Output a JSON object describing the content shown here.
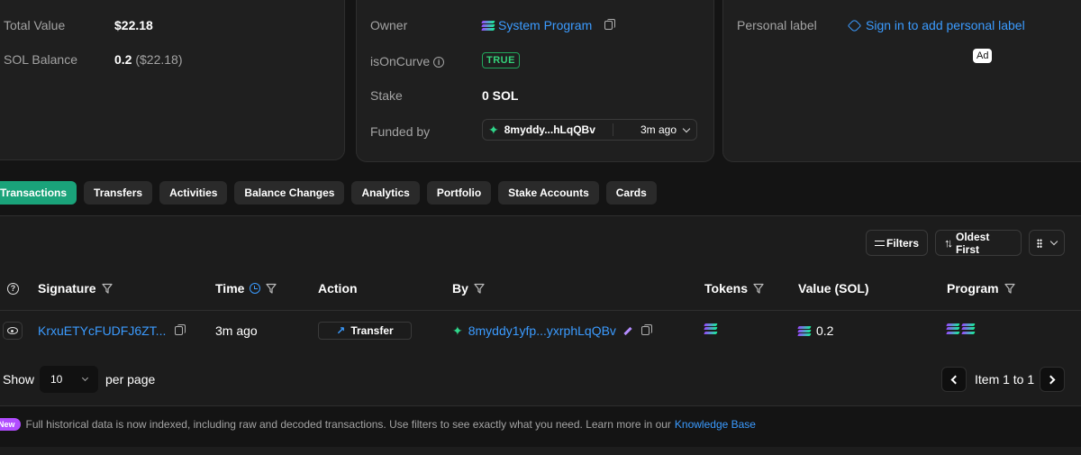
{
  "overview": {
    "total_value_label": "Total Value",
    "total_value": "$22.18",
    "sol_balance_label": "SOL Balance",
    "sol_balance": "0.2",
    "sol_balance_usd": "($22.18)"
  },
  "details": {
    "owner_label": "Owner",
    "owner_value": "System Program",
    "is_on_curve_label": "isOnCurve",
    "is_on_curve_value": "TRUE",
    "stake_label": "Stake",
    "stake_value": "0 SOL",
    "funded_by_label": "Funded by",
    "funded_by_address": "8myddy...hLqQBv",
    "funded_by_time": "3m ago"
  },
  "personal": {
    "label": "Personal label",
    "sign_in_link": "Sign in to add personal label",
    "ad_badge": "Ad"
  },
  "tabs": [
    {
      "label": "Transactions",
      "active": true
    },
    {
      "label": "Transfers"
    },
    {
      "label": "Activities"
    },
    {
      "label": "Balance Changes"
    },
    {
      "label": "Analytics"
    },
    {
      "label": "Portfolio"
    },
    {
      "label": "Stake Accounts"
    },
    {
      "label": "Cards"
    }
  ],
  "toolbar": {
    "filters_label": "Filters",
    "sort_label": "Oldest First"
  },
  "table": {
    "columns": {
      "signature": "Signature",
      "time": "Time",
      "action": "Action",
      "by": "By",
      "tokens": "Tokens",
      "value": "Value (SOL)",
      "program": "Program"
    },
    "rows": [
      {
        "signature": "KrxuETYcFUDFJ6ZT...",
        "time": "3m ago",
        "action": "Transfer",
        "by": "8myddy1yfp...yxrphLqQBv",
        "value": "0.2"
      }
    ]
  },
  "pagination": {
    "show_label": "Show",
    "page_size": "10",
    "per_page_label": "per page",
    "info": "Item 1 to 1"
  },
  "notice": {
    "badge": "New",
    "text": "Full historical data is now indexed, including raw and decoded transactions. Use filters to see exactly what you need. Learn more in our",
    "link": "Knowledge Base"
  },
  "colors": {
    "accent_green": "#1aa37a",
    "link_blue": "#3b9bff",
    "badge_purple": "#b14cff"
  }
}
